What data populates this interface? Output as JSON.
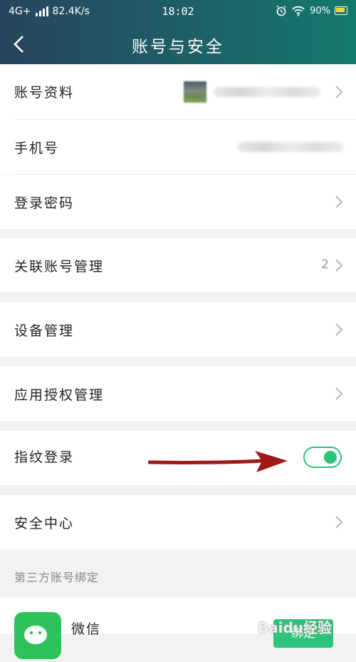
{
  "status_bar": {
    "network": "4G+",
    "speed": "82.4K/s",
    "time": "18:02",
    "battery": "90%"
  },
  "header": {
    "title": "账号与安全"
  },
  "rows": {
    "profile": "账号资料",
    "phone": "手机号",
    "password": "登录密码",
    "linked": "关联账号管理",
    "linked_count": "2",
    "devices": "设备管理",
    "auth": "应用授权管理",
    "fingerprint": "指纹登录",
    "security": "安全中心"
  },
  "fingerprint_toggle": {
    "on": true
  },
  "third_party": {
    "header": "第三方账号绑定",
    "wechat": "微信",
    "bind_label": "绑定"
  },
  "watermark": "Baidu经验",
  "colors": {
    "accent": "#2ec37b",
    "header_start": "#27445e",
    "header_end": "#147a6b",
    "arrow": "#a01818"
  }
}
